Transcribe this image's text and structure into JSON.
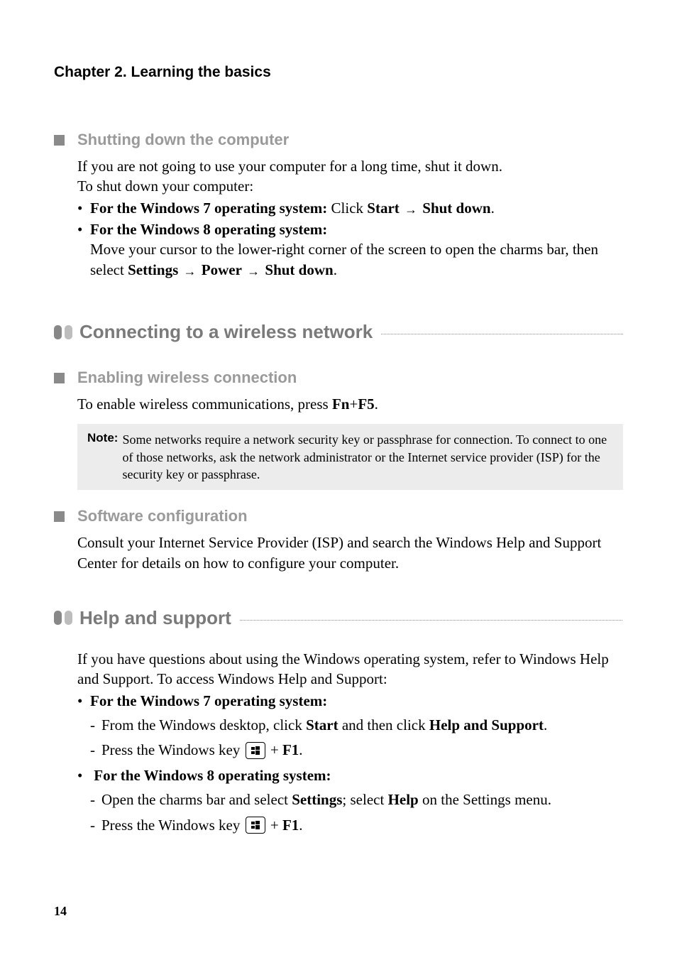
{
  "chapter": "Chapter 2. Learning the basics",
  "sec1": {
    "heading": "Shutting down the computer",
    "p1": "If you are not going to use your computer for a long time, shut it down.",
    "p2": "To shut down your computer:",
    "b1_pre": "For the Windows 7 operating system: ",
    "b1_click": "Click ",
    "b1_start": "Start",
    "b1_shut": "Shut down",
    "b1_dot": ".",
    "b2_pre": "For the Windows 8 operating system:",
    "b2_line1": "Move your cursor to the lower-right corner of the screen to open the charms bar, then select ",
    "b2_settings": "Settings",
    "b2_power": "Power",
    "b2_shut": "Shut down",
    "b2_dot": "."
  },
  "sec2": {
    "title": "Connecting to a wireless network",
    "sub1": {
      "heading": "Enabling wireless connection",
      "p_pre": "To enable wireless communications, press ",
      "fn": "Fn",
      "plus": "+",
      "f5": "F5",
      "dot": "."
    },
    "note": {
      "label": "Note:",
      "text": "Some networks require a network security key or passphrase for connection. To connect to one of those networks, ask the network administrator or the Internet service provider (ISP) for the security key or passphrase."
    },
    "sub2": {
      "heading": "Software configuration",
      "p": "Consult your Internet Service Provider (ISP) and search the Windows Help and Support Center for details on how to configure your computer."
    }
  },
  "sec3": {
    "title": "Help and support",
    "p": "If you have questions about using the Windows operating system, refer to Windows Help and Support. To access Windows Help and Support:",
    "b1_pre": "For the Windows 7 operating system:",
    "b1_d1_pre": "From the Windows desktop, click ",
    "b1_d1_start": "Start",
    "b1_d1_mid": " and then click ",
    "b1_d1_help": "Help and Support",
    "b1_d1_dot": ".",
    "b1_d2_pre": "Press the Windows key ",
    "b1_d2_plus": " + ",
    "b1_d2_f1": "F1",
    "b1_d2_dot": ".",
    "b2_pre": "For the Windows 8 operating system:",
    "b2_d1_pre": "Open the charms bar and select ",
    "b2_d1_settings": "Settings",
    "b2_d1_mid": "; select ",
    "b2_d1_help": "Help",
    "b2_d1_post": " on the Settings menu.",
    "b2_d2_pre": "Press the Windows key ",
    "b2_d2_plus": " + ",
    "b2_d2_f1": "F1",
    "b2_d2_dot": "."
  },
  "page_num": "14"
}
